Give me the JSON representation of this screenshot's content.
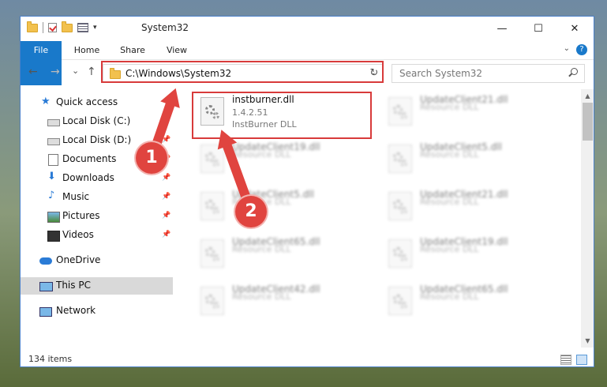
{
  "window": {
    "title": "System32"
  },
  "ribbon": {
    "tabs": [
      "File",
      "Home",
      "Share",
      "View"
    ],
    "help": "?"
  },
  "nav": {
    "back": "←",
    "forward": "→",
    "recent": "⌄",
    "up": "↑"
  },
  "address": {
    "path": "C:\\Windows\\System32",
    "dropdown": "⌄",
    "refresh": "↻"
  },
  "search": {
    "placeholder": "Search System32"
  },
  "sidebar": {
    "items": [
      {
        "label": "Quick access"
      },
      {
        "label": "Local Disk (C:)"
      },
      {
        "label": "Local Disk (D:)"
      },
      {
        "label": "Documents"
      },
      {
        "label": "Downloads"
      },
      {
        "label": "Music"
      },
      {
        "label": "Pictures"
      },
      {
        "label": "Videos"
      },
      {
        "label": "OneDrive"
      },
      {
        "label": "This PC"
      },
      {
        "label": "Network"
      }
    ]
  },
  "files": [
    {
      "name": "instburner.dll",
      "version": "1.4.2.51",
      "desc": "InstBurner DLL"
    },
    {
      "name": "UpdateClient21.dll",
      "desc": "Resource DLL"
    },
    {
      "name": "UpdateClient19.dll",
      "desc": "Resource DLL"
    },
    {
      "name": "UpdateClient5.dll",
      "desc": "Resource DLL"
    },
    {
      "name": "UpdateClient5.dll",
      "desc": "Resource DLL"
    },
    {
      "name": "UpdateClient21.dll",
      "desc": "Resource DLL"
    },
    {
      "name": "UpdateClient65.dll",
      "desc": "Resource DLL"
    },
    {
      "name": "UpdateClient19.dll",
      "desc": "Resource DLL"
    },
    {
      "name": "UpdateClient42.dll",
      "desc": "Resource DLL"
    },
    {
      "name": "UpdateClient65.dll",
      "desc": "Resource DLL"
    }
  ],
  "status": {
    "count": "134 items"
  },
  "annotations": {
    "step1": "1",
    "step2": "2"
  },
  "colors": {
    "accent": "#1979ca",
    "highlight": "#d83b3b"
  }
}
